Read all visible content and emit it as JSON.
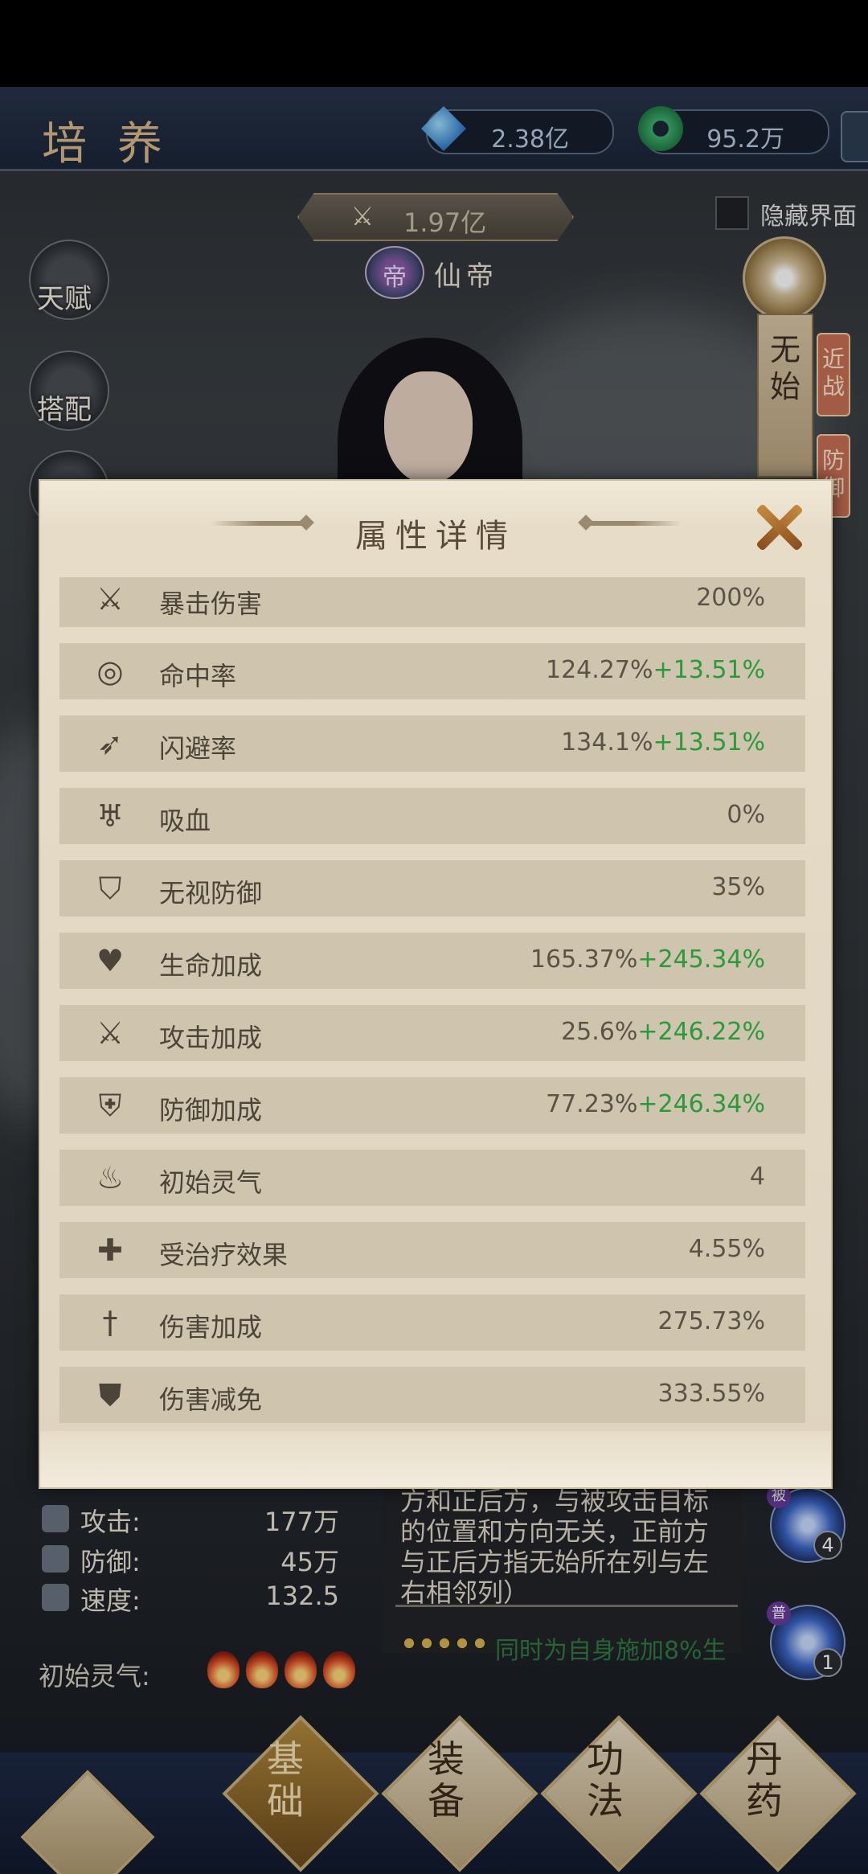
{
  "header": {
    "title": "培养",
    "resources": [
      {
        "name": "crystal",
        "value": "2.38亿"
      },
      {
        "name": "jade",
        "value": "95.2万"
      }
    ]
  },
  "power": {
    "value": "1.97亿"
  },
  "rank": {
    "badge": "帝",
    "name": "仙帝"
  },
  "hide_ui": {
    "label": "隐藏界面",
    "checked": false
  },
  "side_buttons": [
    {
      "label": "天赋"
    },
    {
      "label": "搭配"
    }
  ],
  "character": {
    "name": "无始",
    "tags": [
      "近战",
      "防御"
    ]
  },
  "background_stats": [
    {
      "label": "攻击:",
      "value": "177万"
    },
    {
      "label": "防御:",
      "value": "45万"
    },
    {
      "label": "速度:",
      "value": "132.5"
    }
  ],
  "initial_qi": {
    "label": "初始灵气:",
    "count": 4
  },
  "description": {
    "lines": [
      "方和正后方，与被攻击目标",
      "的位置和方向无关，正前方",
      "与正后方指无始所在列与左",
      "右相邻列）"
    ],
    "next_preview": "同时为自身施加8%生"
  },
  "skills": [
    {
      "level": "4",
      "tag": "被"
    },
    {
      "level": "1",
      "tag": "普"
    }
  ],
  "dialog": {
    "title": "属性详情",
    "rows": [
      {
        "icon": "crit-damage-icon",
        "glyph": "⚔",
        "label": "暴击伤害",
        "value": "200%",
        "bonus": ""
      },
      {
        "icon": "target-icon",
        "glyph": "◎",
        "label": "命中率",
        "value": "124.27%",
        "bonus": "+13.51%"
      },
      {
        "icon": "wing-icon",
        "glyph": "➶",
        "label": "闪避率",
        "value": "134.1%",
        "bonus": "+13.51%"
      },
      {
        "icon": "fang-icon",
        "glyph": "♅",
        "label": "吸血",
        "value": "0%",
        "bonus": ""
      },
      {
        "icon": "pierce-shield-icon",
        "glyph": "⛉",
        "label": "无视防御",
        "value": "35%",
        "bonus": ""
      },
      {
        "icon": "heart-plus-icon",
        "glyph": "♥",
        "label": "生命加成",
        "value": "165.37%",
        "bonus": "+245.34%"
      },
      {
        "icon": "crossed-swords-plus-icon",
        "glyph": "⚔",
        "label": "攻击加成",
        "value": "25.6%",
        "bonus": "+246.22%"
      },
      {
        "icon": "shield-plus-icon",
        "glyph": "⛨",
        "label": "防御加成",
        "value": "77.23%",
        "bonus": "+246.34%"
      },
      {
        "icon": "flame-icon",
        "glyph": "♨",
        "label": "初始灵气",
        "value": "4",
        "bonus": ""
      },
      {
        "icon": "muscle-icon",
        "glyph": "✚",
        "label": "受治疗效果",
        "value": "4.55%",
        "bonus": ""
      },
      {
        "icon": "sword-plus-icon",
        "glyph": "†",
        "label": "伤害加成",
        "value": "275.73%",
        "bonus": ""
      },
      {
        "icon": "shield-reduce-icon",
        "glyph": "⛊",
        "label": "伤害减免",
        "value": "333.55%",
        "bonus": ""
      }
    ]
  },
  "bottom_nav": [
    {
      "label": "基础",
      "active": true
    },
    {
      "label": "装备",
      "active": false
    },
    {
      "label": "功法",
      "active": false
    },
    {
      "label": "丹药",
      "active": false
    }
  ]
}
